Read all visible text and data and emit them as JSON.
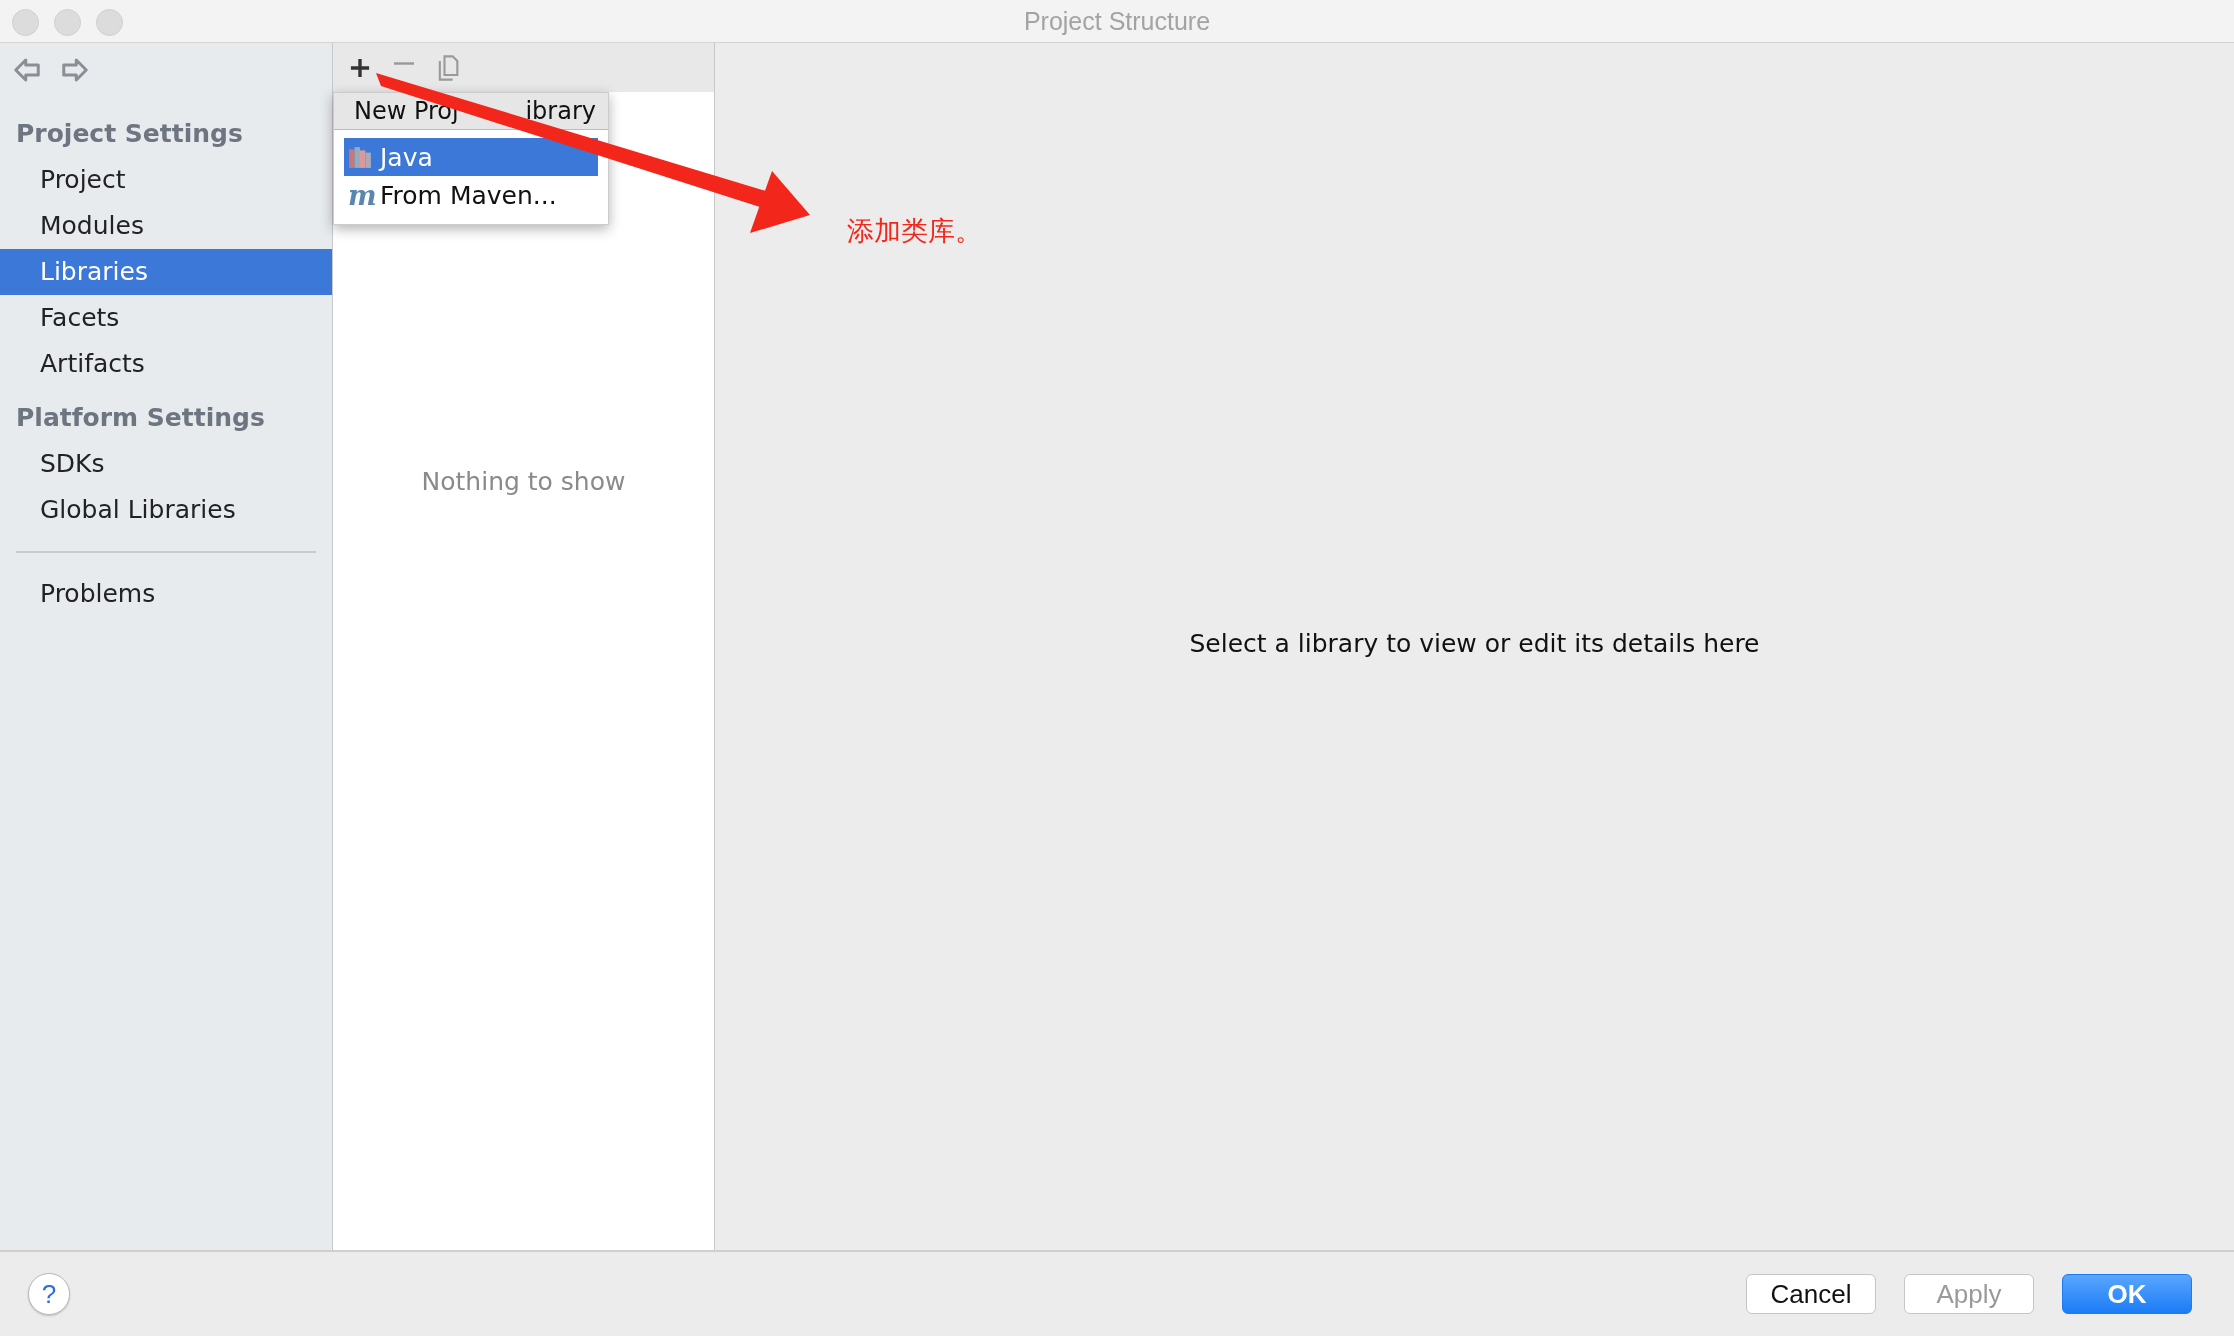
{
  "window": {
    "title": "Project Structure"
  },
  "sidebar": {
    "sections": [
      {
        "header": "Project Settings",
        "items": [
          {
            "label": "Project",
            "selected": false
          },
          {
            "label": "Modules",
            "selected": false
          },
          {
            "label": "Libraries",
            "selected": true
          },
          {
            "label": "Facets",
            "selected": false
          },
          {
            "label": "Artifacts",
            "selected": false
          }
        ]
      },
      {
        "header": "Platform Settings",
        "items": [
          {
            "label": "SDKs",
            "selected": false
          },
          {
            "label": "Global Libraries",
            "selected": false
          }
        ]
      }
    ],
    "bottom_items": [
      {
        "label": "Problems",
        "selected": false
      }
    ]
  },
  "help_button": {
    "label": "?"
  },
  "popup": {
    "title_parts": [
      "New Proj",
      "ibrary"
    ],
    "items": [
      {
        "kind": "library",
        "label": "Java",
        "selected": true
      },
      {
        "kind": "maven",
        "icon": "m",
        "label": "From Maven...",
        "selected": false
      }
    ]
  },
  "list": {
    "empty_text": "Nothing to show"
  },
  "detail": {
    "text": "Select a library to view or edit its details here"
  },
  "annotation": {
    "text": "添加类库。"
  },
  "buttons": [
    {
      "label": "Cancel",
      "kind": "default"
    },
    {
      "label": "Apply",
      "kind": "disabled"
    },
    {
      "label": "OK",
      "kind": "primary"
    }
  ]
}
